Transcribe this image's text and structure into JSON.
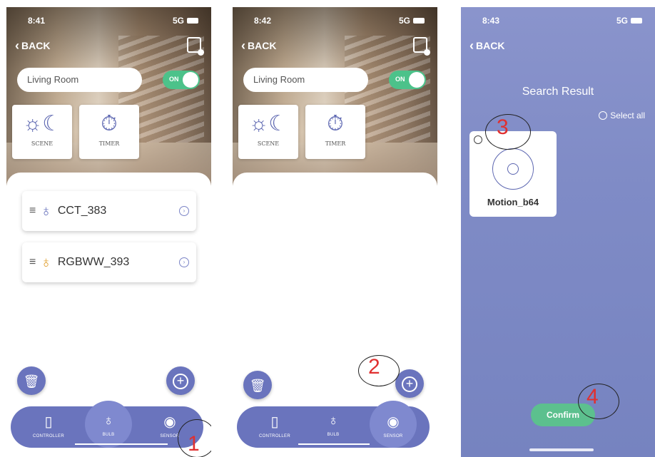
{
  "screen1": {
    "time": "8:41",
    "signal": "5G",
    "back_label": "BACK",
    "room_name": "Living Room",
    "toggle_label": "ON",
    "scene_label": "SCENE",
    "timer_label": "TIMER",
    "devices": [
      {
        "name": "CCT_383"
      },
      {
        "name": "RGBWW_393"
      }
    ],
    "tabs": {
      "controller": "CONTROLLER",
      "bulb": "BULB",
      "sensor": "SENSOR"
    },
    "annotation": "1"
  },
  "screen2": {
    "time": "8:42",
    "signal": "5G",
    "back_label": "BACK",
    "room_name": "Living Room",
    "toggle_label": "ON",
    "scene_label": "SCENE",
    "timer_label": "TIMER",
    "tabs": {
      "controller": "CONTROLLER",
      "bulb": "BULB",
      "sensor": "SENSOR"
    },
    "annotation": "2"
  },
  "screen3": {
    "time": "8:43",
    "signal": "5G",
    "back_label": "BACK",
    "title": "Search Result",
    "select_all": "Select all",
    "result": {
      "name": "Motion_b64"
    },
    "confirm_label": "Confirm",
    "annotation_card": "3",
    "annotation_confirm": "4"
  },
  "colors": {
    "accent": "#6a74bd",
    "toggle_on": "#4cc28a",
    "confirm": "#5cc08e",
    "annotation": "#e03030"
  },
  "icons": {
    "back": "chevron-left-icon",
    "image": "image-settings-icon",
    "scene": "scene-sun-moon-icon",
    "timer": "stopwatch-icon",
    "delete": "trash-icon",
    "add": "plus-circle-icon",
    "controller": "remote-icon",
    "bulb": "bulb-icon",
    "sensor": "sensor-icon"
  }
}
